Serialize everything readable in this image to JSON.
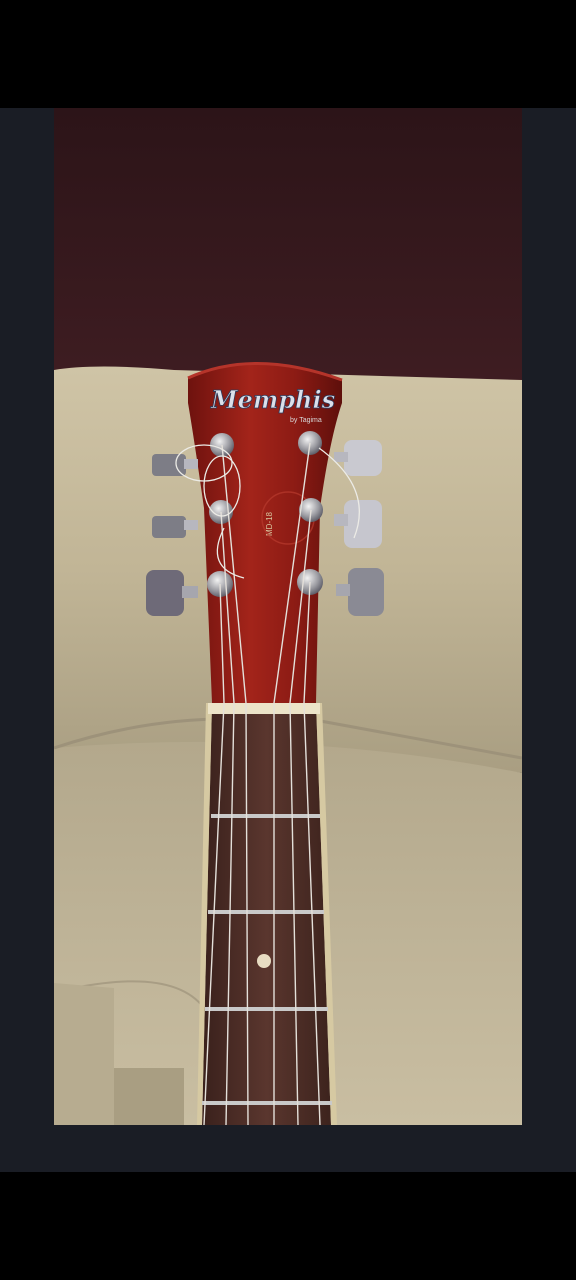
{
  "photo": {
    "brand_logo_text": "Memphis",
    "brand_logo_subtext": "by Tagima",
    "model_text": "MD-18"
  },
  "colors": {
    "frame": "#1a1d25",
    "bars": "#000000",
    "headstock": "#8e1a14",
    "fretboard": "#4a2c26",
    "couch": "#c2b69a",
    "wall": "#3a1a1e"
  }
}
